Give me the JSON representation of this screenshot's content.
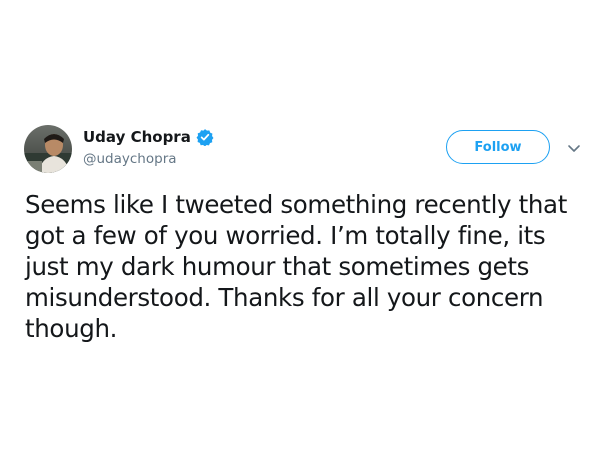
{
  "author": {
    "display_name": "Uday Chopra",
    "handle": "@udaychopra",
    "verified": true,
    "avatar_icon": "profile-photo"
  },
  "actions": {
    "follow_label": "Follow",
    "more_icon": "chevron-down-icon"
  },
  "tweet": {
    "lines": [
      "Seems like I tweeted something recently that",
      "got a few of you worried. I’m totally fine, its",
      "just my dark humour that sometimes gets",
      "misunderstood. Thanks for all your concern",
      "though."
    ]
  },
  "colors": {
    "accent": "#1da1f2",
    "text": "#14171a",
    "secondary_text": "#657786"
  }
}
